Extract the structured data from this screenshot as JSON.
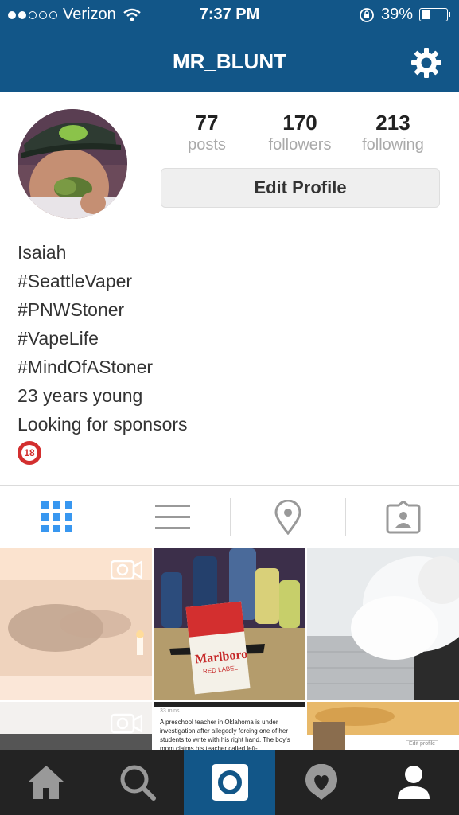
{
  "status_bar": {
    "carrier": "Verizon",
    "time": "7:37 PM",
    "battery": "39%",
    "battery_level": 0.39
  },
  "nav": {
    "title": "MR_BLUNT"
  },
  "stats": [
    {
      "value": "77",
      "label": "posts"
    },
    {
      "value": "170",
      "label": "followers"
    },
    {
      "value": "213",
      "label": "following"
    }
  ],
  "edit_profile_label": "Edit Profile",
  "bio": {
    "name": "Isaiah",
    "lines": [
      "#SeattleVaper",
      "#PNWStoner",
      "#VapeLife",
      "#MindOfAStoner",
      "23 years young",
      "Looking for sponsors"
    ],
    "badge": "18"
  },
  "tabs": [
    "grid-view",
    "list-view",
    "photo-map",
    "tagged-photos"
  ],
  "post_text": {
    "news_caption": "A preschool teacher in Oklahoma is under investigation after allegedly forcing one of her students to write with his right hand. The boy's mom claims his teacher called left-",
    "news_time": "33 mins",
    "cigarette_brand": "Marlboro",
    "cigarette_label": "RED LABEL",
    "mini_edit": "Edit profile"
  },
  "colors": {
    "brand": "#125688",
    "accent": "#3897f0"
  }
}
